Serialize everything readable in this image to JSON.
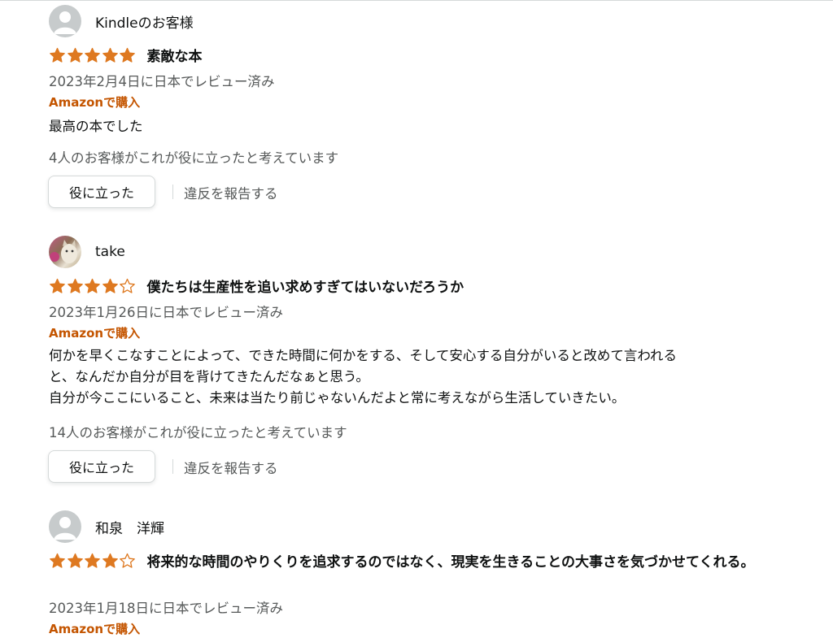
{
  "colors": {
    "star": "#de7921",
    "verified": "#c45500",
    "muted": "#565959"
  },
  "reviews": [
    {
      "author": "Kindleのお客様",
      "avatar": "default-avatar",
      "rating": 5,
      "title": "素敵な本",
      "date": "2023年2月4日に日本でレビュー済み",
      "verified": "Amazonで購入",
      "body": "最高の本でした",
      "helpful_count": "4人のお客様がこれが役に立ったと考えています",
      "helpful_label": "役に立った",
      "report_label": "違反を報告する"
    },
    {
      "author": "take",
      "avatar": "photo-avatar",
      "rating": 4,
      "title": "僕たちは生産性を追い求めすぎてはいないだろうか",
      "date": "2023年1月26日に日本でレビュー済み",
      "verified": "Amazonで購入",
      "body": "何かを早くこなすことによって、できた時間に何かをする、そして安心する自分がいると改めて言われる\nと、なんだか自分が目を背けてきたんだなぁと思う。\n自分が今ここにいること、未来は当たり前じゃないんだよと常に考えながら生活していきたい。",
      "helpful_count": "14人のお客様がこれが役に立ったと考えています",
      "helpful_label": "役に立った",
      "report_label": "違反を報告する"
    },
    {
      "author": "和泉　洋輝",
      "avatar": "default-avatar",
      "rating": 4,
      "title": "将来的な時間のやりくりを追求するのではなく、現実を生きることの大事さを気づかせてくれる。",
      "date": "2023年1月18日に日本でレビュー済み",
      "verified": "Amazonで購入"
    }
  ]
}
